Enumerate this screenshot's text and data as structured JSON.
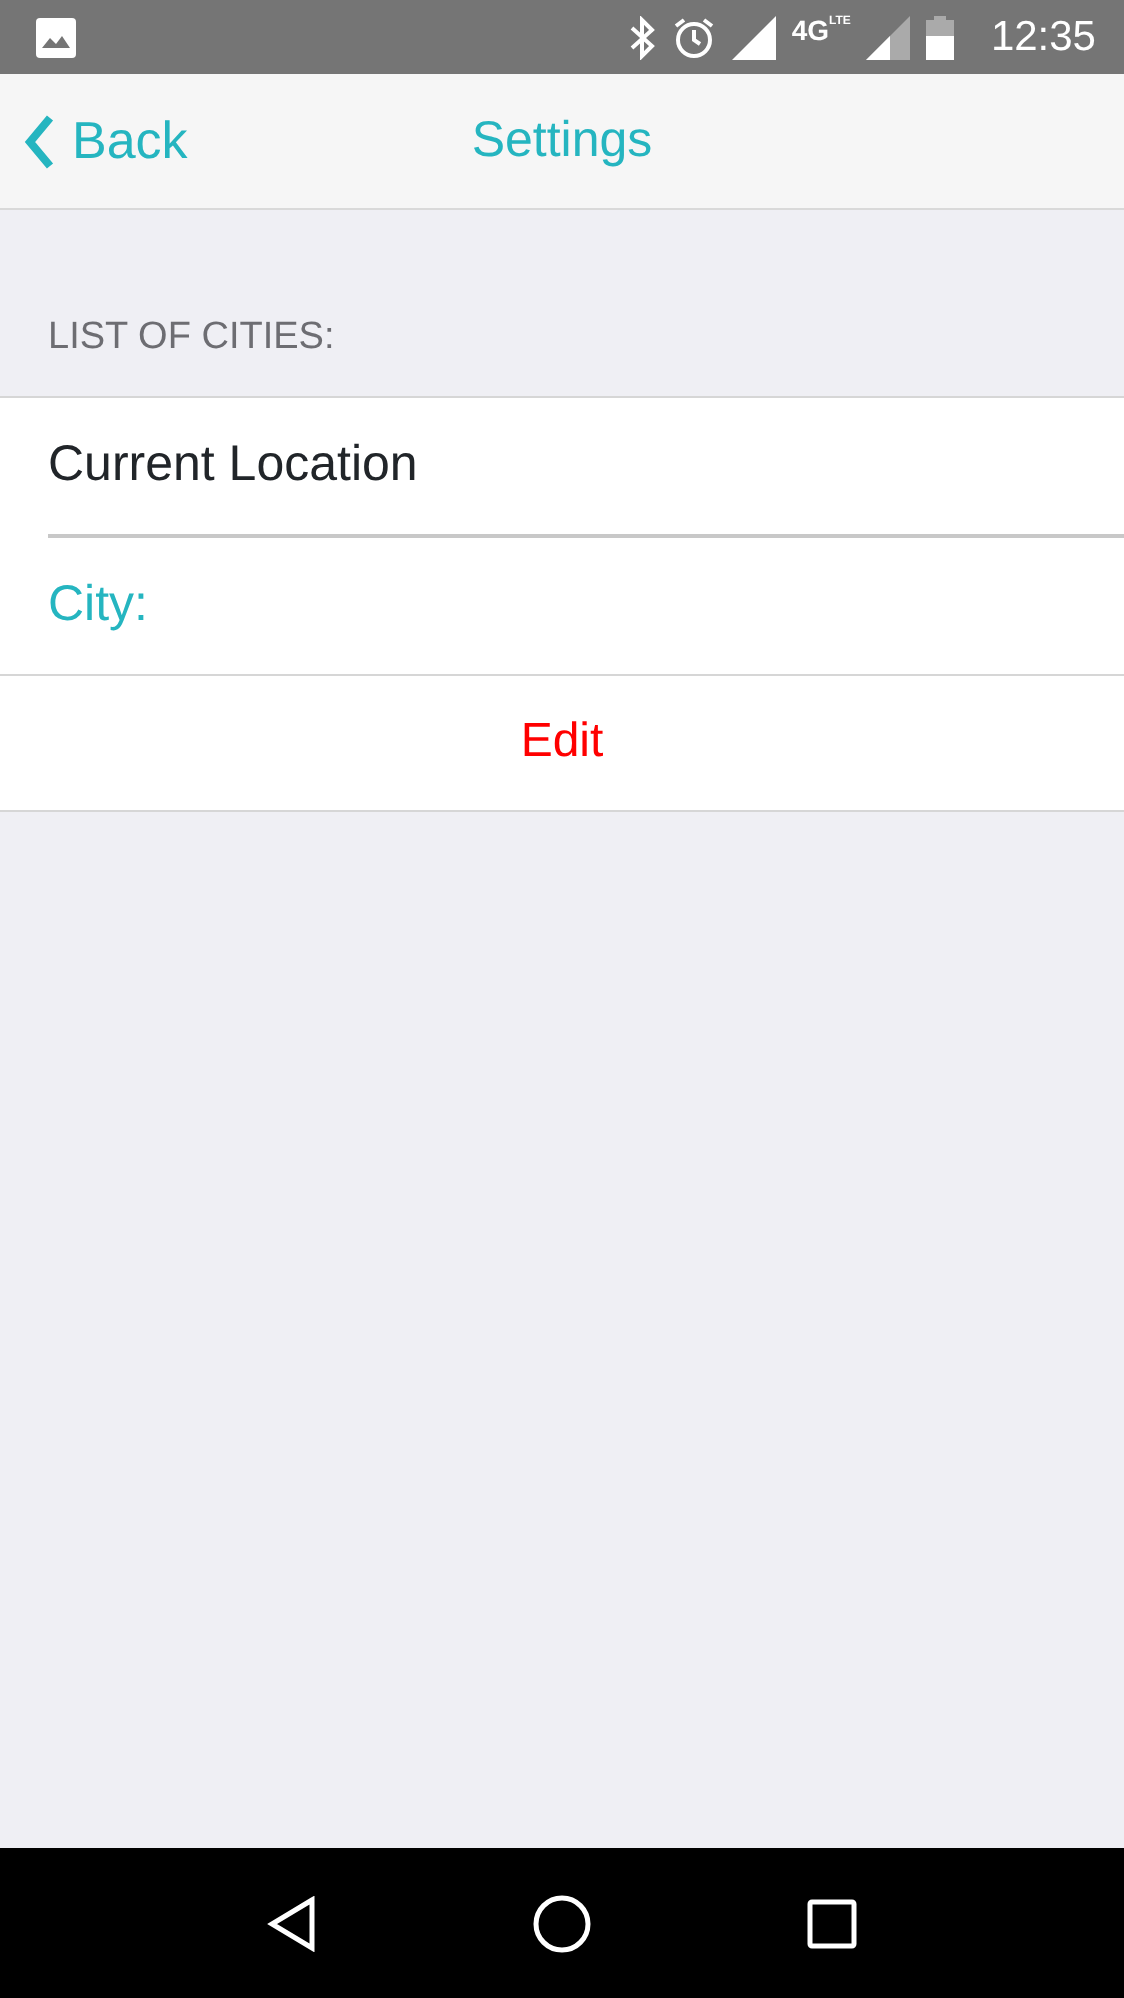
{
  "status_bar": {
    "network": "4G",
    "network_sub": "LTE",
    "time": "12:35"
  },
  "header": {
    "back": "Back",
    "title": "Settings"
  },
  "section": {
    "label": "LIST OF CITIES:"
  },
  "cities": [
    {
      "kind": "item",
      "text": "Current Location"
    },
    {
      "kind": "field-label",
      "text": "City:"
    }
  ],
  "action": {
    "label": "Edit"
  }
}
